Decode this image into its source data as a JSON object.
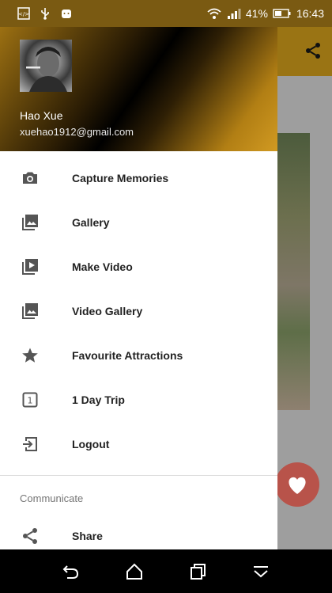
{
  "status_bar": {
    "battery": "41%",
    "time": "16:43"
  },
  "drawer": {
    "user_name": "Hao Xue",
    "user_email": "xuehao1912@gmail.com",
    "items": [
      {
        "label": "Capture Memories",
        "icon": "camera-icon"
      },
      {
        "label": "Gallery",
        "icon": "gallery-icon"
      },
      {
        "label": "Make Video",
        "icon": "video-library-icon"
      },
      {
        "label": "Video Gallery",
        "icon": "gallery-icon"
      },
      {
        "label": "Favourite Attractions",
        "icon": "star-icon"
      },
      {
        "label": "1 Day Trip",
        "icon": "one-day-icon"
      },
      {
        "label": "Logout",
        "icon": "logout-icon"
      }
    ],
    "section_title": "Communicate",
    "section_items": [
      {
        "label": "Share",
        "icon": "share-icon"
      }
    ]
  },
  "colors": {
    "accent": "#d19a22",
    "toolbar": "#9a7414",
    "fab": "#b8534a"
  }
}
